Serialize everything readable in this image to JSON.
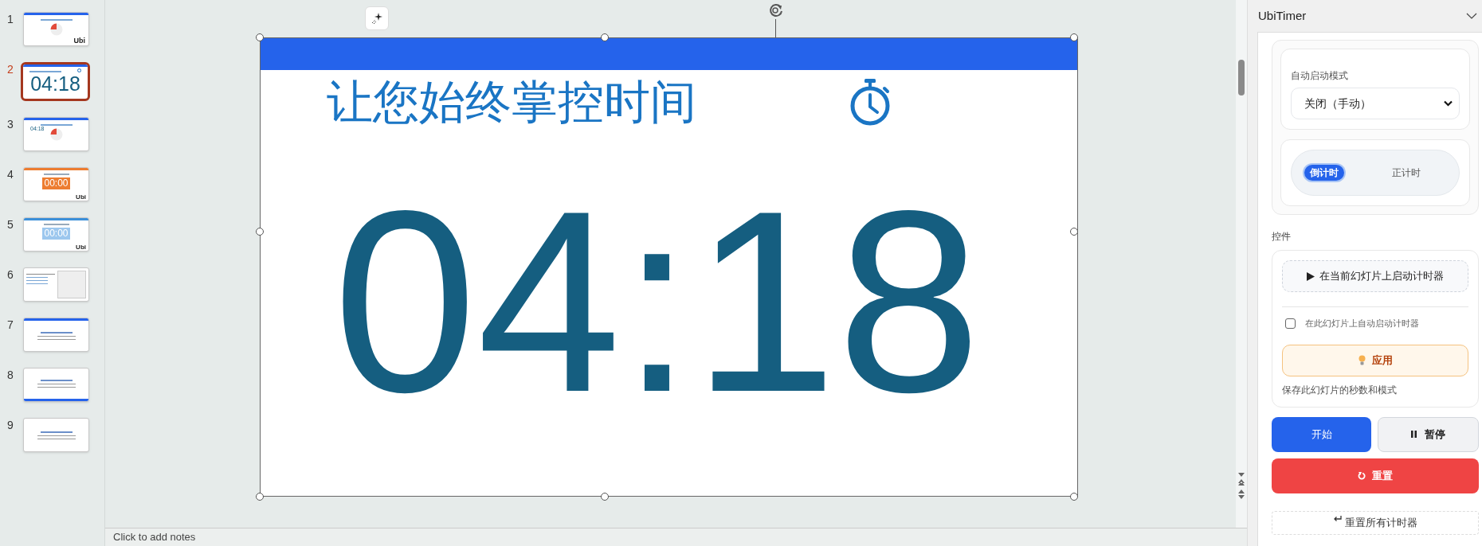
{
  "thumbnails": [
    {
      "number": "1",
      "selected": false,
      "kind": "pie",
      "color": "#2563eb",
      "logo": "Ubi"
    },
    {
      "number": "2",
      "selected": true,
      "kind": "timer",
      "color": "#2563eb",
      "time": "04:18"
    },
    {
      "number": "3",
      "selected": false,
      "kind": "pie",
      "color": "#2563eb",
      "time": "04:18"
    },
    {
      "number": "4",
      "selected": false,
      "kind": "box",
      "color": "#ed7d31",
      "time": "00:00",
      "logo": "Ubi"
    },
    {
      "number": "5",
      "selected": false,
      "kind": "box",
      "color": "#3b8fd9",
      "time": "00:00",
      "logo": "Ubi"
    },
    {
      "number": "6",
      "selected": false,
      "kind": "text-image"
    },
    {
      "number": "7",
      "selected": false,
      "kind": "text",
      "color": "#2563eb"
    },
    {
      "number": "8",
      "selected": false,
      "kind": "text-bottom",
      "color": "#2563eb"
    },
    {
      "number": "9",
      "selected": false,
      "kind": "text"
    }
  ],
  "slide": {
    "title": "让您始终掌控时间",
    "time": "04:18"
  },
  "notes": {
    "placeholder": "Click to add notes"
  },
  "panel": {
    "title": "UbiTimer",
    "auto_start": {
      "label": "自动启动模式",
      "value": "关闭（手动）"
    },
    "modes": [
      {
        "label": "倒计时",
        "selected": true
      },
      {
        "label": "正计时",
        "selected": false
      }
    ],
    "controls_label": "控件",
    "start_on_slide": "在当前幻灯片上启动计时器",
    "auto_checkbox": {
      "label": "在此幻灯片上自动启动计时器",
      "checked": false
    },
    "apply": "应用",
    "apply_hint": "保存此幻灯片的秒数和模式",
    "start": "开始",
    "pause": "暂停",
    "reset": "重置",
    "reset_all": "重置所有计时器"
  }
}
